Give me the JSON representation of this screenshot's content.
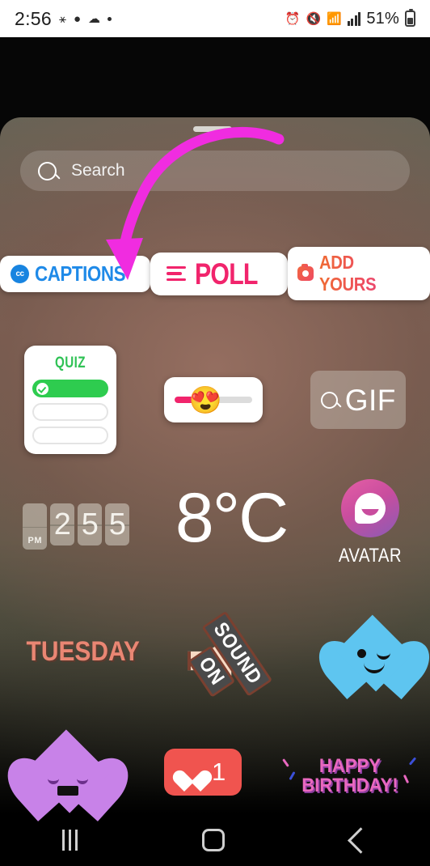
{
  "status_bar": {
    "time": "2:56",
    "battery_percent": "51%",
    "left_icons": [
      "notification-icon",
      "messenger-icon",
      "weather-cloud-icon",
      "dot-icon"
    ],
    "right_icons": [
      "alarm-icon",
      "mute-icon",
      "wifi-icon",
      "signal-icon",
      "battery-icon"
    ]
  },
  "search": {
    "placeholder": "Search",
    "icon": "search-icon"
  },
  "stickers": {
    "row1": [
      {
        "name": "captions",
        "label": "CAPTIONS",
        "icon": "cc-icon",
        "color": "#1f8ae8"
      },
      {
        "name": "poll",
        "label": "POLL",
        "icon": "poll-lines-icon",
        "color": "#f1246c"
      },
      {
        "name": "add-yours",
        "label": "ADD YOURS",
        "icon": "camera-icon",
        "color": "#ee4a63"
      }
    ],
    "row2": [
      {
        "name": "quiz",
        "label": "QUIZ",
        "color": "#2ecc4f"
      },
      {
        "name": "emoji-slider",
        "emoji": "😍",
        "fill_percent": 45,
        "color": "#f1246c"
      },
      {
        "name": "gif",
        "label": "GIF",
        "icon": "search-icon"
      }
    ],
    "row3": [
      {
        "name": "flip-clock",
        "meridiem": "PM",
        "digits": [
          "2",
          "5",
          "5"
        ]
      },
      {
        "name": "temperature",
        "label": "8°C"
      },
      {
        "name": "avatar",
        "label": "AVATAR"
      }
    ],
    "row4": [
      {
        "name": "weekday",
        "label": "TUESDAY",
        "color": "#e98673"
      },
      {
        "name": "sound-on",
        "line1": "SOUND",
        "line2": "ON"
      },
      {
        "name": "blue-heart",
        "color": "#5ec5f0"
      }
    ],
    "row5": [
      {
        "name": "purple-heart",
        "color": "#c882e8"
      },
      {
        "name": "like-counter",
        "count": "1",
        "color": "#f0544f"
      },
      {
        "name": "happy-birthday",
        "line1": "HAPPY",
        "line2": "BIRTHDAY!",
        "color": "#e968c0"
      }
    ]
  },
  "annotation": {
    "arrow_color": "#f02ce0",
    "points_to": "captions"
  },
  "navbar": {
    "recents": "recents-icon",
    "home": "home-icon",
    "back": "back-icon"
  }
}
